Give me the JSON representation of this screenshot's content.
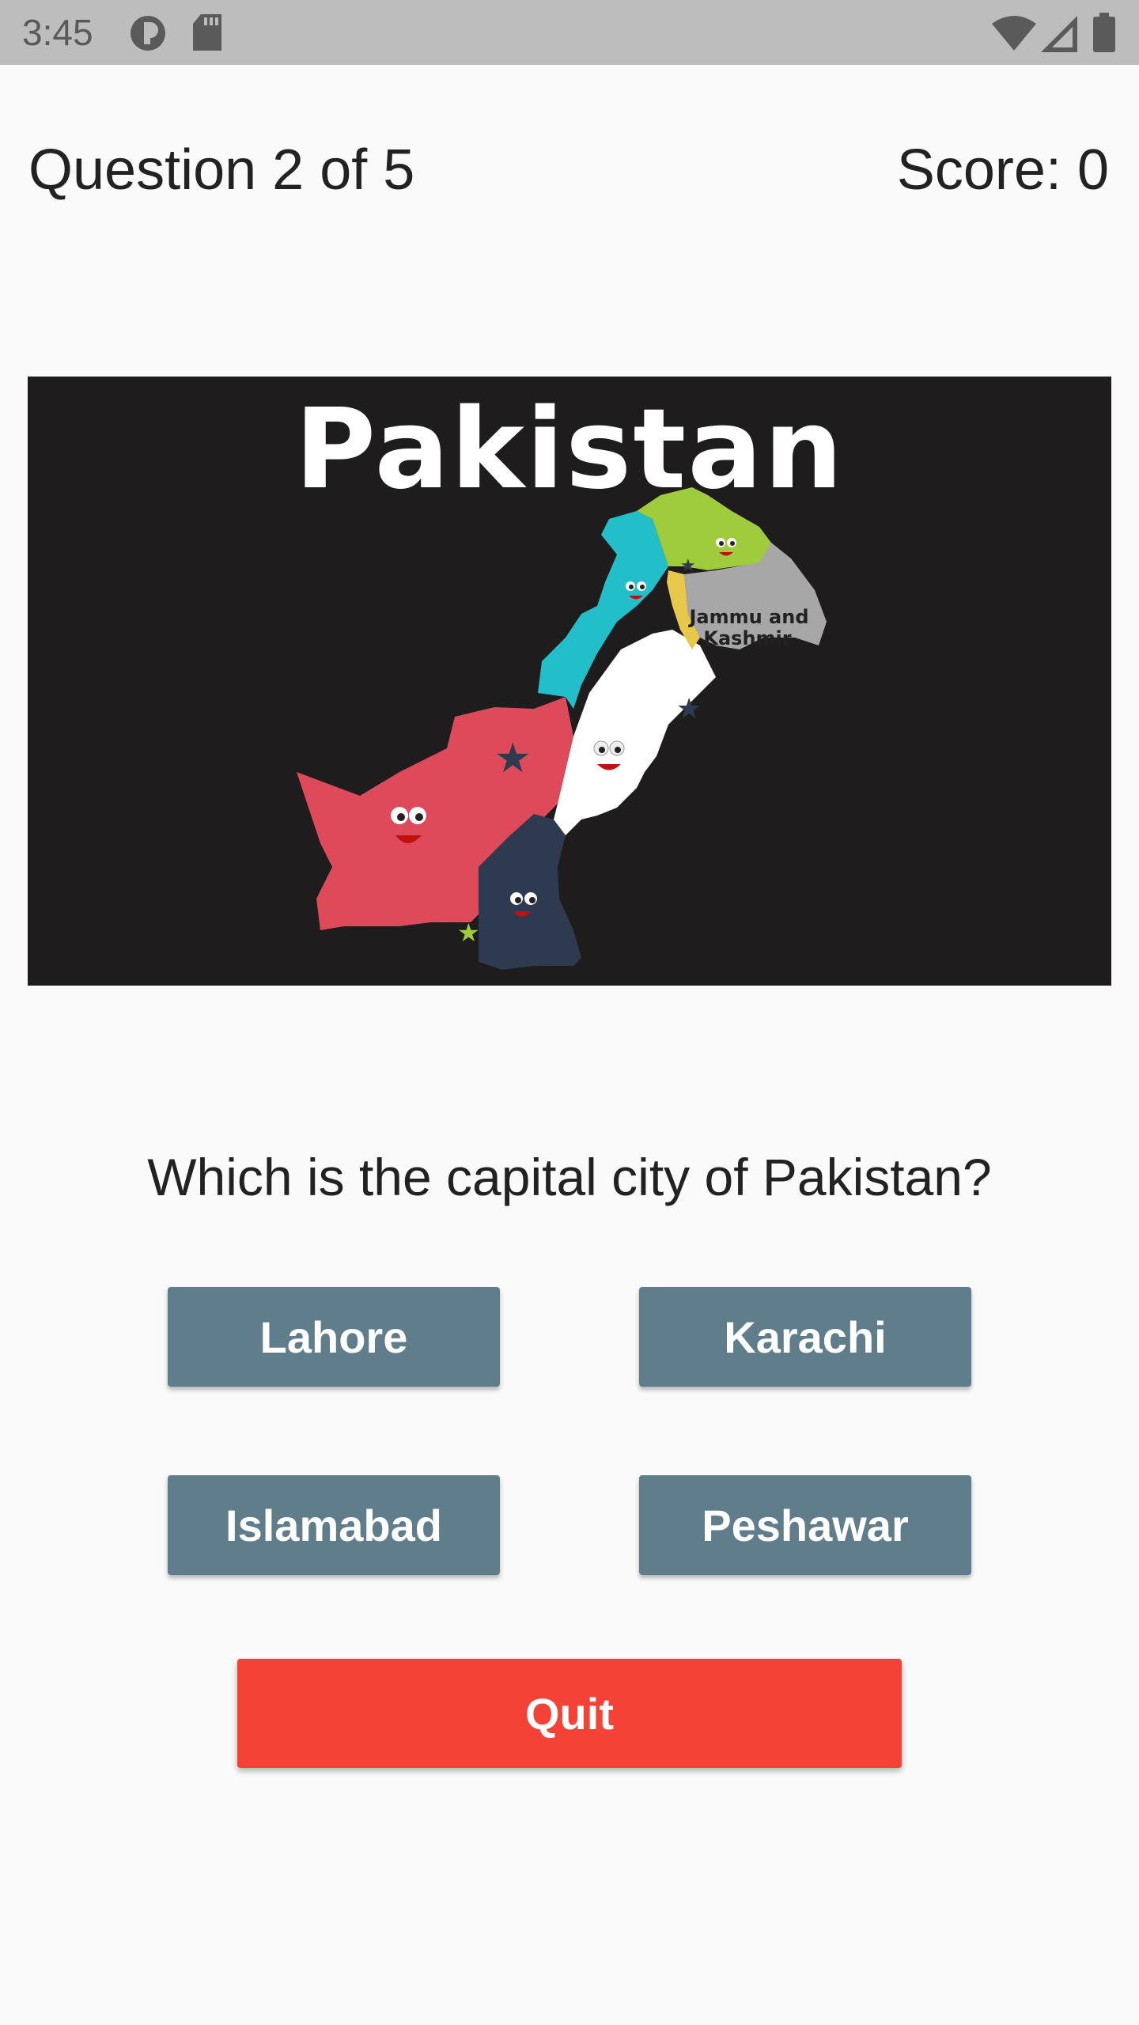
{
  "status_bar": {
    "time": "3:45",
    "icons": [
      "sync-icon",
      "sd-card-icon",
      "wifi-icon",
      "signal-icon",
      "battery-icon"
    ]
  },
  "header": {
    "question_progress": "Question 2 of 5",
    "score": "Score: 0"
  },
  "image": {
    "title": "Pakistan",
    "region_label": "Jammu and Kashmir"
  },
  "question": {
    "text": "Which is the capital city of Pakistan?"
  },
  "options": [
    {
      "label": "Lahore"
    },
    {
      "label": "Karachi"
    },
    {
      "label": "Islamabad"
    },
    {
      "label": "Peshawar"
    }
  ],
  "quit_label": "Quit",
  "colors": {
    "status_bar": "#bdbdbd",
    "background": "#fafafa",
    "option_button": "#607d8b",
    "quit_button": "#f44336",
    "image_bg": "#1f1c1d"
  }
}
